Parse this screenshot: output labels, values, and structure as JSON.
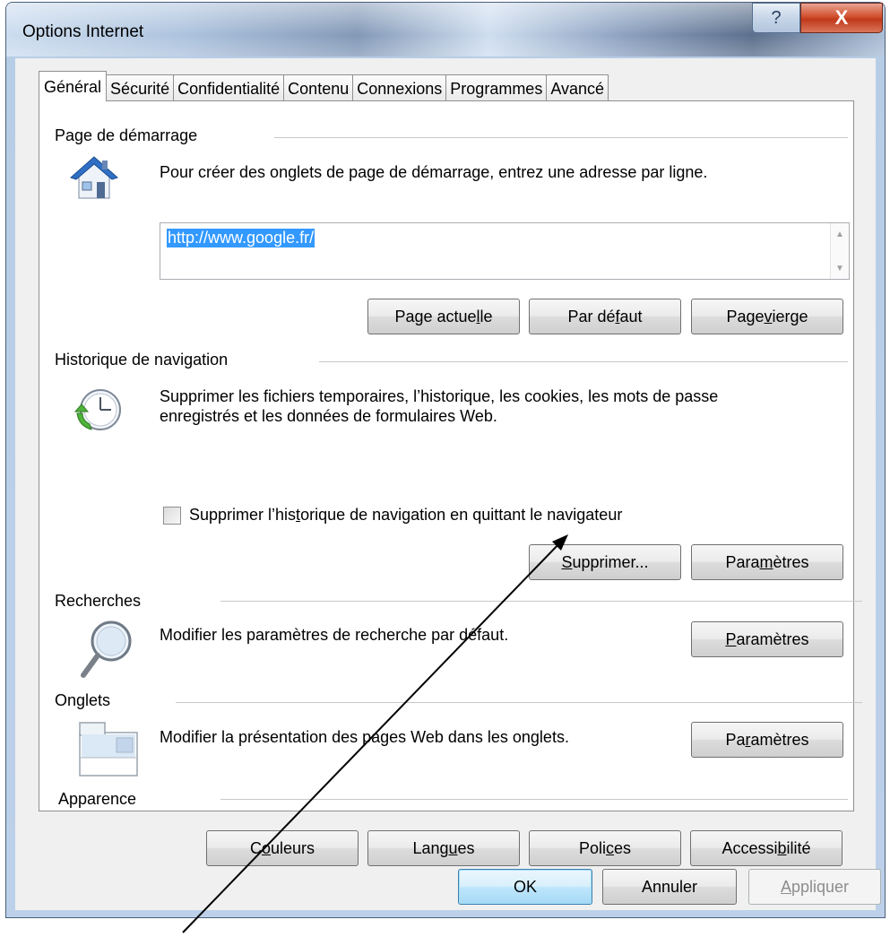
{
  "window": {
    "title": "Options Internet",
    "help_glyph": "?",
    "close_glyph": "X"
  },
  "tabs": [
    {
      "label": "Général",
      "active": true
    },
    {
      "label": "Sécurité"
    },
    {
      "label": "Confidentialité"
    },
    {
      "label": "Contenu"
    },
    {
      "label": "Connexions"
    },
    {
      "label": "Programmes"
    },
    {
      "label": "Avancé"
    }
  ],
  "startup": {
    "title": "Page de démarrage",
    "description": "Pour créer des onglets de page de démarrage, entrez une adresse par ligne.",
    "url_value": "http://www.google.fr/",
    "icon": "home-icon",
    "buttons": {
      "current": {
        "pre": "Page actue",
        "key": "l",
        "post": "le"
      },
      "default": {
        "pre": "Par dé",
        "key": "f",
        "post": "aut"
      },
      "blank": {
        "pre": "Page ",
        "key": "v",
        "post": "ierge"
      }
    }
  },
  "history": {
    "title": "Historique de navigation",
    "description_line1": "Supprimer les fichiers temporaires, l’historique, les cookies, les mots de passe",
    "description_line2": "enregistrés et les données de formulaires Web.",
    "icon": "history-clock-icon",
    "checkbox": {
      "pre": "Supprimer l’his",
      "key": "t",
      "post": "orique de navigation en quittant le navigateur",
      "checked": false
    },
    "buttons": {
      "delete": {
        "pre": "",
        "key": "S",
        "post": "upprimer..."
      },
      "settings": {
        "pre": "Para",
        "key": "m",
        "post": "ètres"
      }
    }
  },
  "search": {
    "title": "Recherches",
    "description": "Modifier les paramètres de recherche par défaut.",
    "icon": "magnifier-icon",
    "button": {
      "pre": "",
      "key": "P",
      "post": "aramètres"
    }
  },
  "tabs_section": {
    "title": "Onglets",
    "description": "Modifier la présentation des pages Web dans les onglets.",
    "icon": "tabs-window-icon",
    "button": {
      "pre": "Pa",
      "key": "r",
      "post": "amètres"
    }
  },
  "appearance": {
    "title": "Apparence",
    "buttons": {
      "colors": {
        "pre": "C",
        "key": "o",
        "post": "uleurs"
      },
      "languages": {
        "pre": "Lang",
        "key": "u",
        "post": "es"
      },
      "fonts": {
        "pre": "Poli",
        "key": "c",
        "post": "es"
      },
      "accessibility": {
        "pre": "Accessi",
        "key": "b",
        "post": "ilité"
      }
    }
  },
  "footer": {
    "ok": "OK",
    "cancel": "Annuler",
    "apply": {
      "pre": "",
      "key": "A",
      "post": "ppliquer"
    }
  },
  "colors": {
    "selection": "#3399ff",
    "default_button_border": "#3c7fb1",
    "close_red": "#c0391a"
  }
}
